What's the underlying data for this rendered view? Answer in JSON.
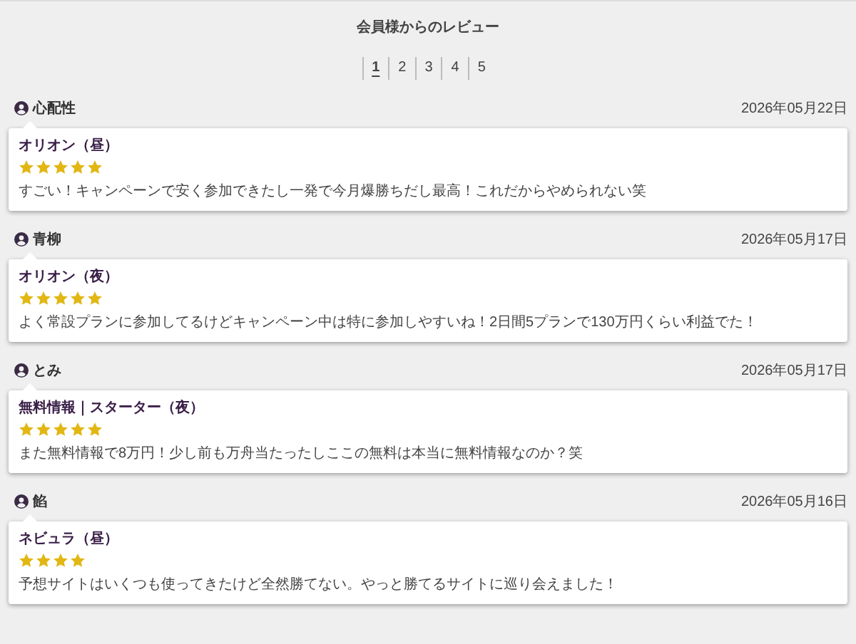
{
  "title": "会員様からのレビュー",
  "pagination": [
    {
      "label": "1",
      "selected": true
    },
    {
      "label": "2",
      "selected": false
    },
    {
      "label": "3",
      "selected": false
    },
    {
      "label": "4",
      "selected": false
    },
    {
      "label": "5",
      "selected": false
    }
  ],
  "reviews": [
    {
      "user": "心配性",
      "date": "2026年05月22日",
      "plan": "オリオン（昼）",
      "stars": 5,
      "text": "すごい！キャンペーンで安く参加できたし一発で今月爆勝ちだし最高！これだからやめられない笑"
    },
    {
      "user": "青柳",
      "date": "2026年05月17日",
      "plan": "オリオン（夜）",
      "stars": 5,
      "text": "よく常設プランに参加してるけどキャンペーン中は特に参加しやすいね！2日間5プランで130万円くらい利益でた！"
    },
    {
      "user": "とみ",
      "date": "2026年05月17日",
      "plan": "無料情報｜スターター（夜）",
      "stars": 5,
      "text": "また無料情報で8万円！少し前も万舟当たったしここの無料は本当に無料情報なのか？笑"
    },
    {
      "user": "餡",
      "date": "2026年05月16日",
      "plan": "ネビュラ（昼）",
      "stars": 4,
      "text": "予想サイトはいくつも使ってきたけど全然勝てない。やっと勝てるサイトに巡り会えました！"
    }
  ]
}
